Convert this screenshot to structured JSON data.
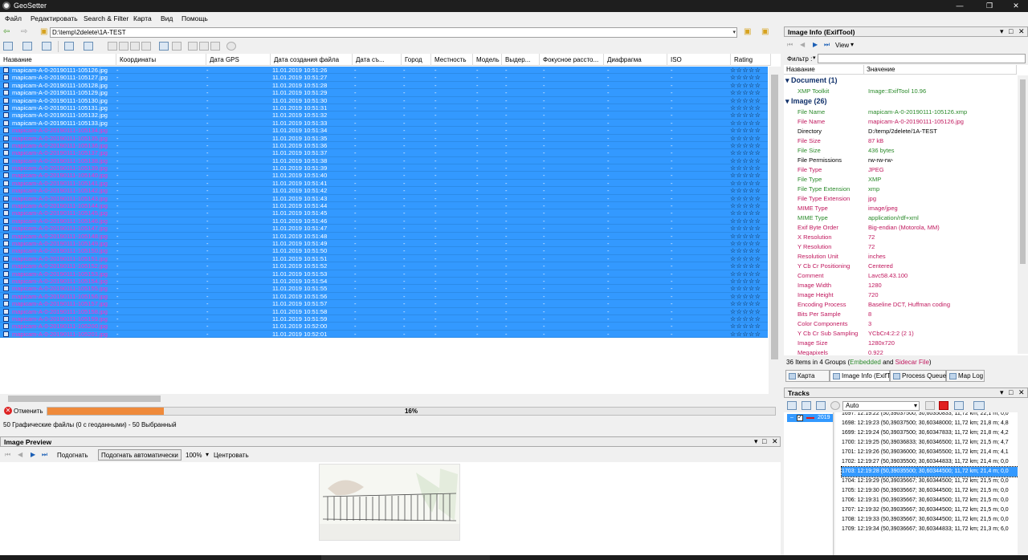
{
  "window": {
    "title": "GeoSetter",
    "min": "—",
    "max": "❐",
    "close": "✕"
  },
  "menu": [
    "Файл",
    "Редактировать",
    "Search & Filter",
    "Карта",
    "Вид",
    "Помощь"
  ],
  "path": {
    "value": "D:\\temp\\2delete\\1A-TEST"
  },
  "grid": {
    "headers": [
      "Название",
      "Координаты",
      "Дата GPS",
      "Дата создания файла",
      "Дата съ...",
      "Город",
      "Местность",
      "Модель",
      "Выдер...",
      "Фокусное рассто...",
      "Диафрагма",
      "ISO",
      "Rating"
    ],
    "dash": "-",
    "stars": "☆☆☆☆☆",
    "rows": [
      {
        "name": "mapicam-A-0-20190111-105126.jpg",
        "date": "11.01.2019 10:51:26",
        "purple": false
      },
      {
        "name": "mapicam-A-0-20190111-105127.jpg",
        "date": "11.01.2019 10:51:27",
        "purple": false
      },
      {
        "name": "mapicam-A-0-20190111-105128.jpg",
        "date": "11.01.2019 10:51:28",
        "purple": false
      },
      {
        "name": "mapicam-A-0-20190111-105129.jpg",
        "date": "11.01.2019 10:51:29",
        "purple": false
      },
      {
        "name": "mapicam-A-0-20190111-105130.jpg",
        "date": "11.01.2019 10:51:30",
        "purple": false
      },
      {
        "name": "mapicam-A-0-20190111-105131.jpg",
        "date": "11.01.2019 10:51:31",
        "purple": false
      },
      {
        "name": "mapicam-A-0-20190111-105132.jpg",
        "date": "11.01.2019 10:51:32",
        "purple": false
      },
      {
        "name": "mapicam-A-0-20190111-105133.jpg",
        "date": "11.01.2019 10:51:33",
        "purple": false
      },
      {
        "name": "mapicam-A-0-20190111-105134.jpg",
        "date": "11.01.2019 10:51:34",
        "purple": true
      },
      {
        "name": "mapicam-A-0-20190111-105135.jpg",
        "date": "11.01.2019 10:51:35",
        "purple": true
      },
      {
        "name": "mapicam-A-0-20190111-105136.jpg",
        "date": "11.01.2019 10:51:36",
        "purple": true
      },
      {
        "name": "mapicam-A-0-20190111-105137.jpg",
        "date": "11.01.2019 10:51:37",
        "purple": true
      },
      {
        "name": "mapicam-A-0-20190111-105138.jpg",
        "date": "11.01.2019 10:51:38",
        "purple": true
      },
      {
        "name": "mapicam-A-0-20190111-105139.jpg",
        "date": "11.01.2019 10:51:39",
        "purple": true
      },
      {
        "name": "mapicam-A-0-20190111-105140.jpg",
        "date": "11.01.2019 10:51:40",
        "purple": true
      },
      {
        "name": "mapicam-A-0-20190111-105141.jpg",
        "date": "11.01.2019 10:51:41",
        "purple": true
      },
      {
        "name": "mapicam-A-0-20190111-105142.jpg",
        "date": "11.01.2019 10:51:42",
        "purple": true
      },
      {
        "name": "mapicam-A-0-20190111-105143.jpg",
        "date": "11.01.2019 10:51:43",
        "purple": true
      },
      {
        "name": "mapicam-A-0-20190111-105144.jpg",
        "date": "11.01.2019 10:51:44",
        "purple": true
      },
      {
        "name": "mapicam-A-0-20190111-105145.jpg",
        "date": "11.01.2019 10:51:45",
        "purple": true
      },
      {
        "name": "mapicam-A-0-20190111-105146.jpg",
        "date": "11.01.2019 10:51:46",
        "purple": true
      },
      {
        "name": "mapicam-A-0-20190111-105147.jpg",
        "date": "11.01.2019 10:51:47",
        "purple": true
      },
      {
        "name": "mapicam-A-0-20190111-105148.jpg",
        "date": "11.01.2019 10:51:48",
        "purple": true
      },
      {
        "name": "mapicam-A-0-20190111-105149.jpg",
        "date": "11.01.2019 10:51:49",
        "purple": true
      },
      {
        "name": "mapicam-A-0-20190111-105150.jpg",
        "date": "11.01.2019 10:51:50",
        "purple": true
      },
      {
        "name": "mapicam-A-0-20190111-105151.jpg",
        "date": "11.01.2019 10:51:51",
        "purple": true
      },
      {
        "name": "mapicam-A-0-20190111-105152.jpg",
        "date": "11.01.2019 10:51:52",
        "purple": true
      },
      {
        "name": "mapicam-A-0-20190111-105153.jpg",
        "date": "11.01.2019 10:51:53",
        "purple": true
      },
      {
        "name": "mapicam-A-0-20190111-105154.jpg",
        "date": "11.01.2019 10:51:54",
        "purple": true
      },
      {
        "name": "mapicam-A-0-20190111-105155.jpg",
        "date": "11.01.2019 10:51:55",
        "purple": true
      },
      {
        "name": "mapicam-A-0-20190111-105156.jpg",
        "date": "11.01.2019 10:51:56",
        "purple": true
      },
      {
        "name": "mapicam-A-0-20190111-105157.jpg",
        "date": "11.01.2019 10:51:57",
        "purple": true
      },
      {
        "name": "mapicam-A-0-20190111-105158.jpg",
        "date": "11.01.2019 10:51:58",
        "purple": true
      },
      {
        "name": "mapicam-A-0-20190111-105159.jpg",
        "date": "11.01.2019 10:51:59",
        "purple": true
      },
      {
        "name": "mapicam-A-0-20190111-105200.jpg",
        "date": "11.01.2019 10:52:00",
        "purple": true
      },
      {
        "name": "mapicam-A-0-20190111-105201.jpg",
        "date": "11.01.2019 10:52:01",
        "purple": true
      }
    ]
  },
  "progress": {
    "cancel_label": "Отменить",
    "percent_text": "16%",
    "fraction": 0.16
  },
  "status_line": "50 Графические файлы    (0 с геоданными)  - 50 Выбранный",
  "preview": {
    "title": "Image Preview",
    "fit_label": "Подогнать",
    "auto_fit_label": "Подогнать автоматически",
    "zoom": "100%",
    "center_label": "Центровать"
  },
  "info": {
    "title": "Image Info (ExifTool)",
    "view_label": "View",
    "filter_label": "Фильтр :",
    "col_name": "Название",
    "col_value": "Значение",
    "groups": [
      {
        "label": "Document (1)",
        "rows": [
          {
            "k": "XMP Toolkit",
            "v": "Image::ExifTool 10.96",
            "color": "#2a8a2a"
          }
        ]
      },
      {
        "label": "Image (26)",
        "rows": [
          {
            "k": "File Name",
            "v": "mapicam-A-0-20190111-105126.xmp",
            "color": "#2a8a2a"
          },
          {
            "k": "File Name",
            "v": "mapicam-A-0-20190111-105126.jpg",
            "color": "#c0175d"
          },
          {
            "k": "Directory",
            "v": "D:/temp/2delete/1A-TEST",
            "color": "#000000"
          },
          {
            "k": "File Size",
            "v": "87 kB",
            "color": "#c0175d"
          },
          {
            "k": "File Size",
            "v": "436 bytes",
            "color": "#2a8a2a"
          },
          {
            "k": "File Permissions",
            "v": "rw-rw-rw-",
            "color": "#000000"
          },
          {
            "k": "File Type",
            "v": "JPEG",
            "color": "#c0175d"
          },
          {
            "k": "File Type",
            "v": "XMP",
            "color": "#2a8a2a"
          },
          {
            "k": "File Type Extension",
            "v": "xmp",
            "color": "#2a8a2a"
          },
          {
            "k": "File Type Extension",
            "v": "jpg",
            "color": "#c0175d"
          },
          {
            "k": "MIME Type",
            "v": "image/jpeg",
            "color": "#c0175d"
          },
          {
            "k": "MIME Type",
            "v": "application/rdf+xml",
            "color": "#2a8a2a"
          },
          {
            "k": "Exif Byte Order",
            "v": "Big-endian (Motorola, MM)",
            "color": "#c0175d"
          },
          {
            "k": "X Resolution",
            "v": "72",
            "color": "#c0175d"
          },
          {
            "k": "Y Resolution",
            "v": "72",
            "color": "#c0175d"
          },
          {
            "k": "Resolution Unit",
            "v": "inches",
            "color": "#c0175d"
          },
          {
            "k": "Y Cb Cr Positioning",
            "v": "Centered",
            "color": "#c0175d"
          },
          {
            "k": "Comment",
            "v": "Lavc58.43.100",
            "color": "#c0175d"
          },
          {
            "k": "Image Width",
            "v": "1280",
            "color": "#c0175d"
          },
          {
            "k": "Image Height",
            "v": "720",
            "color": "#c0175d"
          },
          {
            "k": "Encoding Process",
            "v": "Baseline DCT, Huffman coding",
            "color": "#c0175d"
          },
          {
            "k": "Bits Per Sample",
            "v": "8",
            "color": "#c0175d"
          },
          {
            "k": "Color Components",
            "v": "3",
            "color": "#c0175d"
          },
          {
            "k": "Y Cb Cr Sub Sampling",
            "v": "YCbCr4:2:2 (2 1)",
            "color": "#c0175d"
          },
          {
            "k": "Image Size",
            "v": "1280x720",
            "color": "#c0175d"
          },
          {
            "k": "Megapixels",
            "v": "0.922",
            "color": "#c0175d"
          }
        ]
      }
    ],
    "status_a": "36 Items in 4 Groups  (",
    "status_embedded": "Embedded",
    "status_and": " and ",
    "status_sidecar": "Sidecar File",
    "status_end": ")"
  },
  "tabs": [
    "Карта",
    "Image Info (ExifTool)",
    "Process Queue",
    "Map Log"
  ],
  "tracks": {
    "title": "Tracks",
    "auto": "Auto",
    "track_name": "2019",
    "rows": [
      "1697: 12:19:22 (50,39037500; 30,60350833; 11,72 km; 22,1 m; 0,0",
      "1698: 12:19:23 (50,39037500; 30,60348000; 11,72 km; 21,8 m; 4,8",
      "1699: 12:19:24 (50,39037500; 30,60347833; 11,72 km; 21,8 m; 4,2",
      "1700: 12:19:25 (50,39036833; 30,60346500; 11,72 km; 21,5 m; 4,7",
      "1701: 12:19:26 (50,39036000; 30,60345500; 11,72 km; 21,4 m; 4,1",
      "1702: 12:19:27 (50,39035500; 30,60344833; 11,72 km; 21,4 m; 0,0",
      "1703: 12:19:28 (50,39035500; 30,60344500; 11,72 km; 21,4 m; 0,0",
      "1704: 12:19:29 (50,39035667; 30,60344500; 11,72 km; 21,5 m; 0,0",
      "1705: 12:19:30 (50,39035667; 30,60344500; 11,72 km; 21,5 m; 0,0",
      "1706: 12:19:31 (50,39035667; 30,60344500; 11,72 km; 21,5 m; 0,0",
      "1707: 12:19:32 (50,39035667; 30,60344500; 11,72 km; 21,5 m; 0,0",
      "1708: 12:19:33 (50,39035667; 30,60344500; 11,72 km; 21,5 m; 0,0",
      "1709: 12:19:34 (50,39036667; 30,60344833; 11,72 km; 21,3 m; 6,0"
    ],
    "selected_index": 6
  },
  "colors": {
    "selection": "#3399ff",
    "purple_text": "#ff2dc8",
    "progress": "#ef8a3b"
  }
}
